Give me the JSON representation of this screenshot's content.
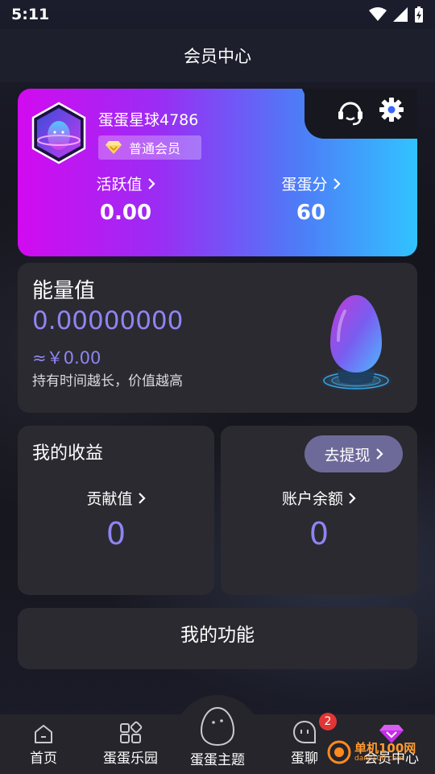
{
  "status_bar": {
    "time": "5:11"
  },
  "header": {
    "title": "会员中心"
  },
  "profile": {
    "nickname": "蛋蛋星球4786",
    "member_level": "普通会员",
    "activity_label": "活跃值",
    "activity_value": "0.00",
    "egg_score_label": "蛋蛋分",
    "egg_score_value": "60",
    "icons": [
      "headset-icon",
      "gear-icon"
    ]
  },
  "energy": {
    "title": "能量值",
    "value": "0.00000000",
    "cny": "≈￥0.00",
    "description": "持有时间越长，价值越高"
  },
  "income": {
    "title": "我的收益",
    "contribution_label": "贡献值",
    "contribution_value": "0"
  },
  "balance": {
    "withdraw_label": "去提现",
    "label": "账户余额",
    "value": "0"
  },
  "functions": {
    "title": "我的功能"
  },
  "tabbar": {
    "tabs": [
      {
        "label": "首页",
        "icon": "home-icon"
      },
      {
        "label": "蛋蛋乐园",
        "icon": "grid-icon"
      },
      {
        "label": "蛋蛋主题",
        "icon": "egg-face-icon"
      },
      {
        "label": "蛋聊",
        "icon": "chat-face-icon",
        "badge": "2"
      },
      {
        "label": "会员中心",
        "icon": "gem-icon"
      }
    ]
  },
  "watermark": {
    "text": "单机100网",
    "sub": "danji100.com"
  },
  "colors": {
    "accent": "#8f84f2",
    "panel": "#2a2a30",
    "badge": "#e23535",
    "gradient_start": "#d20af0",
    "gradient_end": "#31c3ff"
  }
}
